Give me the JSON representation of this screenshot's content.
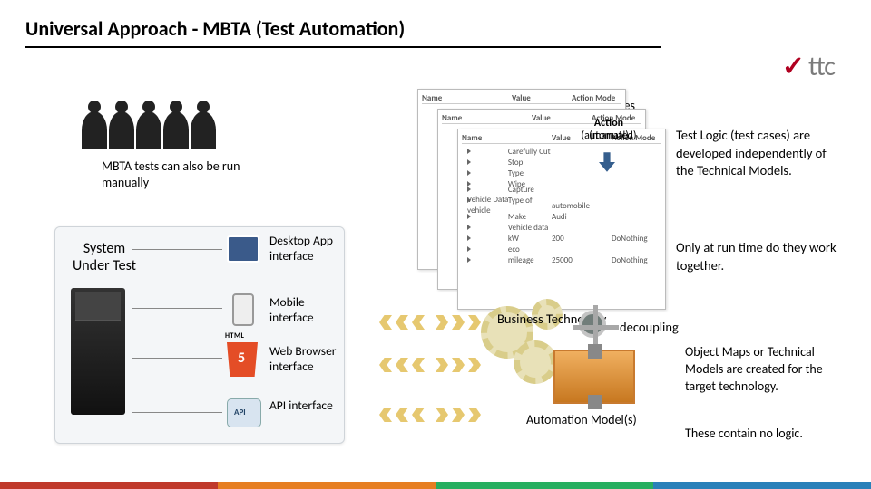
{
  "title": "Universal Approach - MBTA (Test Automation)",
  "logo": {
    "text": "ttc"
  },
  "note_manual": "MBTA tests can also be run manually",
  "system_under_test": "System Under Test",
  "interfaces": {
    "desktop": "Desktop App interface",
    "mobile": "Mobile interface",
    "html_tag": "HTML",
    "web": "Web Browser interface",
    "api": "API interface"
  },
  "test_cases_label": "Test Cases",
  "card_headers": [
    "Name",
    "Value",
    "Action Mode"
  ],
  "card_rows": [
    [
      "Carefully Cut",
      "",
      ""
    ],
    [
      "Stop",
      "",
      ""
    ],
    [
      "Type",
      "",
      ""
    ],
    [
      "Wipe",
      "",
      ""
    ],
    [
      "Capture Vehicle Data",
      "",
      ""
    ],
    [
      "Type of vehicle",
      "automobile",
      ""
    ],
    [
      "Make",
      "Audi",
      ""
    ],
    [
      "Vehicle data",
      "",
      ""
    ],
    [
      "kW",
      "200",
      "DoNothing"
    ],
    [
      "eco",
      "",
      ""
    ],
    [
      "mileage",
      "25000",
      "DoNothing"
    ]
  ],
  "action_badge": {
    "line1": "Action",
    "line2_a": "(manual)",
    "line2_b": "(automated)"
  },
  "decouple": {
    "biz": "Business Technology",
    "label": "decoupling"
  },
  "automation_model": "Automation Model(s)",
  "right": {
    "p1": "Test Logic (test cases) are developed independently of the Technical Models.",
    "p2": "Only at run time do they work together.",
    "p3": "Object Maps or Technical Models are created for the target technology.",
    "p4": "These contain no logic."
  }
}
